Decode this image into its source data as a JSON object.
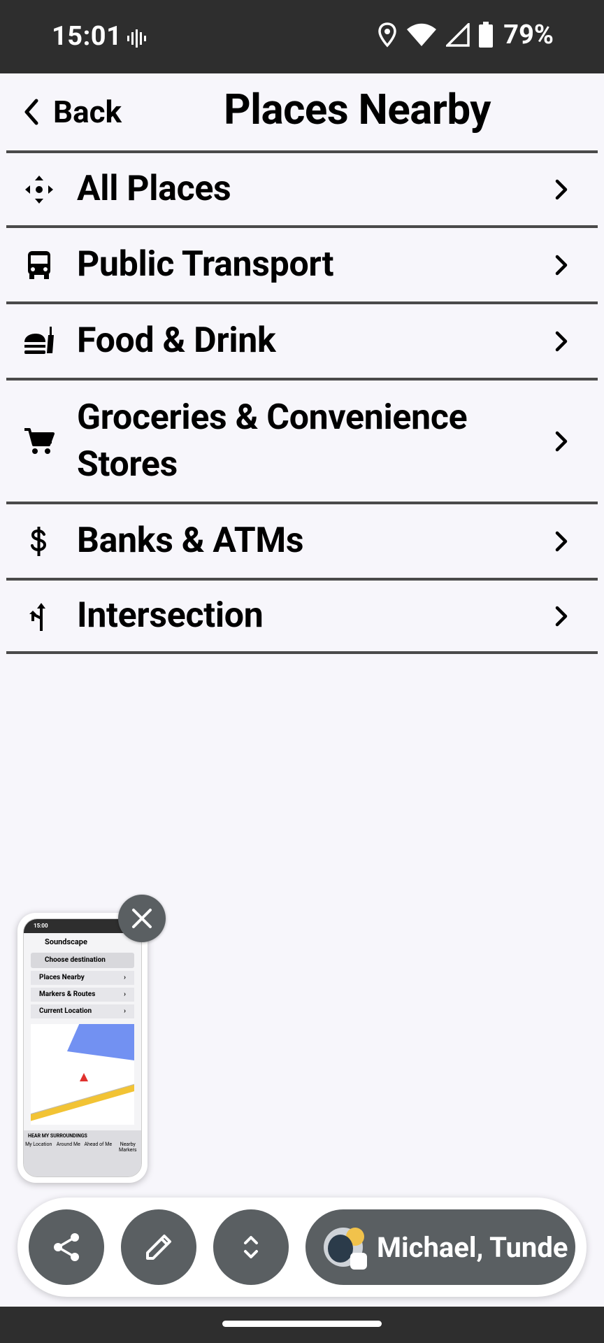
{
  "status_bar": {
    "time": "15:01",
    "battery": "79%",
    "icons": [
      "sound-wave-icon",
      "location-icon",
      "wifi-icon",
      "cell-signal-icon",
      "battery-icon"
    ]
  },
  "header": {
    "back_label": "Back",
    "title": "Places Nearby"
  },
  "list": {
    "items": [
      {
        "label": "All Places",
        "icon": "all-places-icon"
      },
      {
        "label": "Public Transport",
        "icon": "bus-icon"
      },
      {
        "label": "Food & Drink",
        "icon": "food-icon"
      },
      {
        "label": "Groceries & Convenience Stores",
        "icon": "cart-icon"
      },
      {
        "label": "Banks & ATMs",
        "icon": "dollar-icon"
      },
      {
        "label": "Intersection",
        "icon": "turn-icon"
      }
    ]
  },
  "preview": {
    "status_time": "15:00",
    "app_title": "Soundscape",
    "search_label": "Choose destination",
    "items": [
      "Places Nearby",
      "Markers & Routes",
      "Current Location"
    ],
    "bottom_title": "HEAR MY SURROUNDINGS",
    "tabs": [
      "My Location",
      "Around Me",
      "Ahead of Me",
      "Nearby Markers"
    ]
  },
  "toolbar": {
    "chat_label": "Michael, Tunde"
  },
  "colors": {
    "status_bar_bg": "#2e2e2e",
    "page_bg": "#f7f6fb",
    "divider": "#4a4a4a",
    "button_bg": "#5a5f62"
  }
}
